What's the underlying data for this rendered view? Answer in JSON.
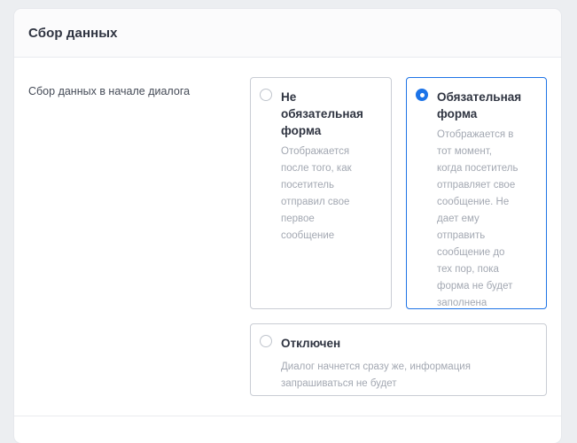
{
  "section": {
    "title": "Сбор данных"
  },
  "field": {
    "label": "Сбор данных в начале диалога"
  },
  "options": [
    {
      "title": "Не обязательная форма",
      "description": "Отображается после того, как посетитель отправил свое первое сообщение",
      "selected": false
    },
    {
      "title": "Обязательная форма",
      "description": "Отображается в тот момент, когда посетитель отправляет свое сообщение. Не дает ему отправить сообщение до тех пор, пока форма не будет заполнена",
      "selected": true
    },
    {
      "title": "Отключен",
      "description": "Диалог начнется сразу же, информация запрашиваться не будет",
      "selected": false
    }
  ],
  "colors": {
    "accent": "#1b73e8",
    "title_text": "#2f3441",
    "muted_text": "#a3a8b2",
    "border": "#c9cdd4"
  }
}
